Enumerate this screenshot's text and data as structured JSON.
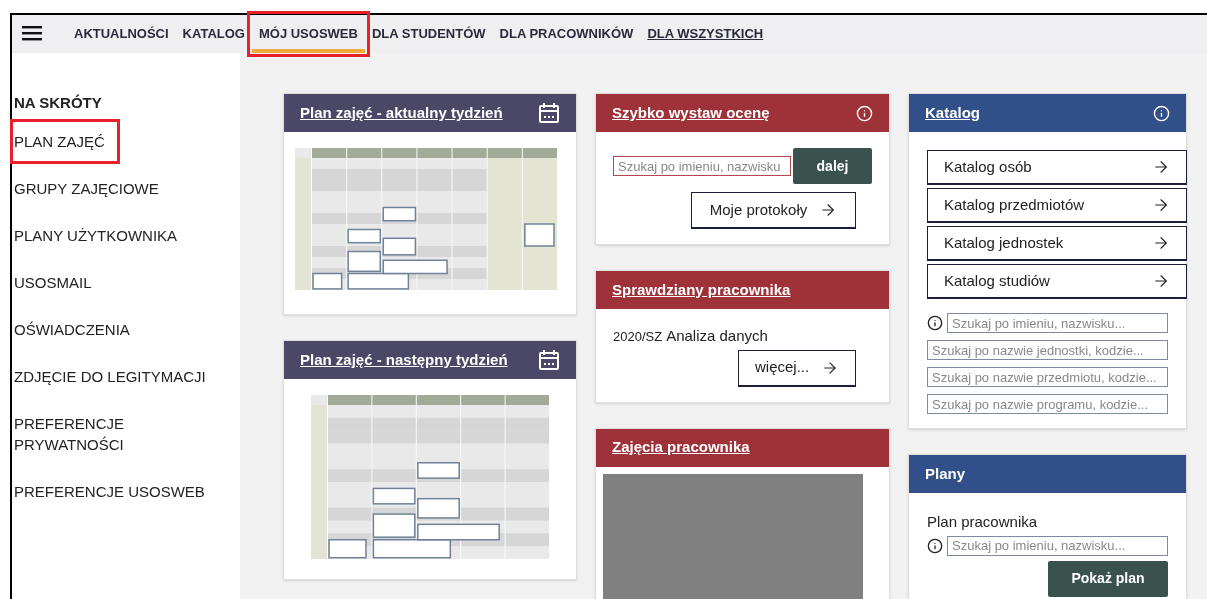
{
  "nav": {
    "items": [
      {
        "label": "AKTUALNOŚCI",
        "selected": false,
        "underlined": false,
        "annotated": false
      },
      {
        "label": "KATALOG",
        "selected": false,
        "underlined": false,
        "annotated": false
      },
      {
        "label": "MÓJ USOSWEB",
        "selected": true,
        "underlined": false,
        "annotated": true
      },
      {
        "label": "DLA STUDENTÓW",
        "selected": false,
        "underlined": false,
        "annotated": false
      },
      {
        "label": "DLA PRACOWNIKÓW",
        "selected": false,
        "underlined": false,
        "annotated": false
      },
      {
        "label": "DLA WSZYSTKICH",
        "selected": false,
        "underlined": true,
        "annotated": false
      }
    ]
  },
  "sidebar": {
    "heading": "NA SKRÓTY",
    "items": [
      {
        "label": "PLAN ZAJĘĆ",
        "annotated": true
      },
      {
        "label": "GRUPY ZAJĘCIOWE",
        "annotated": false
      },
      {
        "label": "PLANY UŻYTKOWNIKA",
        "annotated": false
      },
      {
        "label": "USOSMAIL",
        "annotated": false
      },
      {
        "label": "OŚWIADCZENIA",
        "annotated": false
      },
      {
        "label": "ZDJĘCIE DO LEGITYMACJI",
        "annotated": false
      },
      {
        "label": "PREFERENCJE PRYWATNOŚCI",
        "annotated": false
      },
      {
        "label": "PREFERENCJE USOSWEB",
        "annotated": false
      }
    ]
  },
  "columns": [
    [
      {
        "kind": "timetable",
        "title": "Plan zajęć - aktualny tydzień",
        "color": "#4b4767",
        "link": true
      },
      {
        "kind": "timetable",
        "title": "Plan zajęć - następny tydzień",
        "color": "#4b4767",
        "link": true
      }
    ],
    [
      {
        "kind": "grade",
        "title": "Szybko wystaw ocenę",
        "color": "#9e3238",
        "link": true,
        "info": true,
        "search": {
          "placeholder": "Szukaj po imieniu, nazwisku"
        },
        "submit": "dalej",
        "protocols": "Moje protokoły"
      },
      {
        "kind": "exams",
        "title": "Sprawdziany pracownika",
        "color": "#9e3238",
        "link": true,
        "info": false,
        "code": "2020/SZ",
        "name": "Analiza danych",
        "more": "więcej..."
      },
      {
        "kind": "classes",
        "title": "Zajęcia pracownika",
        "color": "#9e3238",
        "link": true,
        "info": false
      }
    ],
    [
      {
        "kind": "catalog",
        "title": "Katalog",
        "color": "#31508a",
        "link": true,
        "info": true,
        "links": [
          "Katalog osób",
          "Katalog przedmiotów",
          "Katalog jednostek",
          "Katalog studiów"
        ],
        "searches": [
          {
            "placeholder": "Szukaj po imieniu, nazwisku...",
            "info": true
          },
          {
            "placeholder": "Szukaj po nazwie jednostki, kodzie...",
            "info": false
          },
          {
            "placeholder": "Szukaj po nazwie przedmiotu, kodzie...",
            "info": false
          },
          {
            "placeholder": "Szukaj po nazwie programu, kodzie...",
            "info": false
          }
        ]
      },
      {
        "kind": "plans",
        "title": "Plany",
        "color": "#31508a",
        "link": false,
        "info": false,
        "label": "Plan pracownika",
        "search": {
          "placeholder": "Szukaj po imieniu, nazwisku...",
          "info": true
        },
        "submit": "Pokaż plan"
      }
    ]
  ]
}
